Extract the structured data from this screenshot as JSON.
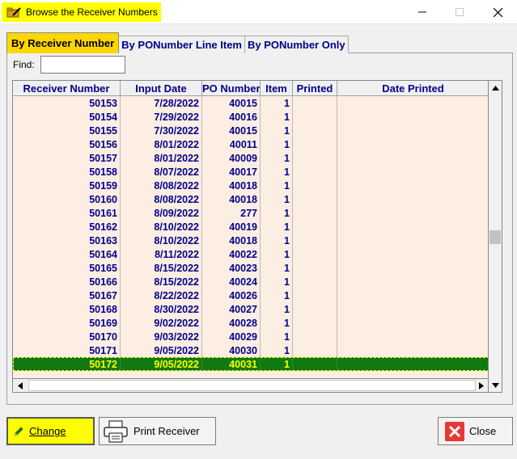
{
  "window": {
    "title": "Browse the Receiver Numbers",
    "icons": {
      "app": "folder-pencil-icon",
      "minimize": "minimize-icon",
      "maximize": "maximize-icon",
      "close": "close-icon"
    }
  },
  "tabs": [
    {
      "label": "By Receiver Number",
      "active": true
    },
    {
      "label": "By PONumber Line Item",
      "active": false
    },
    {
      "label": "By PONumber Only",
      "active": false
    }
  ],
  "find": {
    "label": "Find:",
    "value": ""
  },
  "grid": {
    "columns": [
      "Receiver Number",
      "Input Date",
      "PO Number",
      "Item",
      "Printed",
      "Date Printed"
    ],
    "rows": [
      [
        "50153",
        "7/28/2022",
        "40015",
        "1",
        "",
        ""
      ],
      [
        "50154",
        "7/29/2022",
        "40016",
        "1",
        "",
        ""
      ],
      [
        "50155",
        "7/30/2022",
        "40015",
        "1",
        "",
        ""
      ],
      [
        "50156",
        "8/01/2022",
        "40011",
        "1",
        "",
        ""
      ],
      [
        "50157",
        "8/01/2022",
        "40009",
        "1",
        "",
        ""
      ],
      [
        "50158",
        "8/07/2022",
        "40017",
        "1",
        "",
        ""
      ],
      [
        "50159",
        "8/08/2022",
        "40018",
        "1",
        "",
        ""
      ],
      [
        "50160",
        "8/08/2022",
        "40018",
        "1",
        "",
        ""
      ],
      [
        "50161",
        "8/09/2022",
        "277",
        "1",
        "",
        ""
      ],
      [
        "50162",
        "8/10/2022",
        "40019",
        "1",
        "",
        ""
      ],
      [
        "50163",
        "8/10/2022",
        "40018",
        "1",
        "",
        ""
      ],
      [
        "50164",
        "8/11/2022",
        "40022",
        "1",
        "",
        ""
      ],
      [
        "50165",
        "8/15/2022",
        "40023",
        "1",
        "",
        ""
      ],
      [
        "50166",
        "8/15/2022",
        "40024",
        "1",
        "",
        ""
      ],
      [
        "50167",
        "8/22/2022",
        "40026",
        "1",
        "",
        ""
      ],
      [
        "50168",
        "8/30/2022",
        "40027",
        "1",
        "",
        ""
      ],
      [
        "50169",
        "9/02/2022",
        "40028",
        "1",
        "",
        ""
      ],
      [
        "50170",
        "9/03/2022",
        "40029",
        "1",
        "",
        ""
      ],
      [
        "50171",
        "9/05/2022",
        "40030",
        "1",
        "",
        ""
      ],
      [
        "50172",
        "9/05/2022",
        "40031",
        "1",
        "",
        ""
      ]
    ],
    "selected_index": 19,
    "colors": {
      "body": "#fdeee4",
      "selected_bg": "#107a10",
      "selected_text": "#ffff00",
      "text": "#00008b"
    }
  },
  "buttons": {
    "change": {
      "label": "Change",
      "icon": "pencil-icon"
    },
    "print": {
      "label": "Print Receiver",
      "icon": "printer-icon"
    },
    "close": {
      "label": "Close",
      "icon": "close-x-icon"
    }
  }
}
